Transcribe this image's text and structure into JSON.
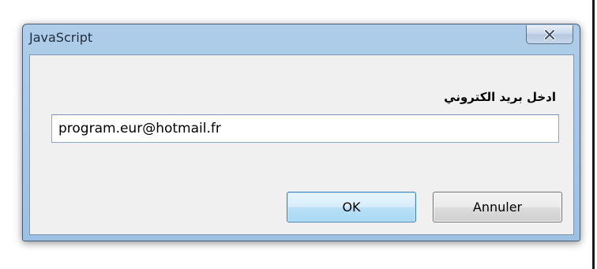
{
  "dialog": {
    "title": "JavaScript",
    "close_icon": "close-x-icon",
    "prompt": "ادخل بريد الكتروني",
    "input_value": "program.eur@hotmail.fr",
    "ok_label": "OK",
    "cancel_label": "Annuler"
  }
}
